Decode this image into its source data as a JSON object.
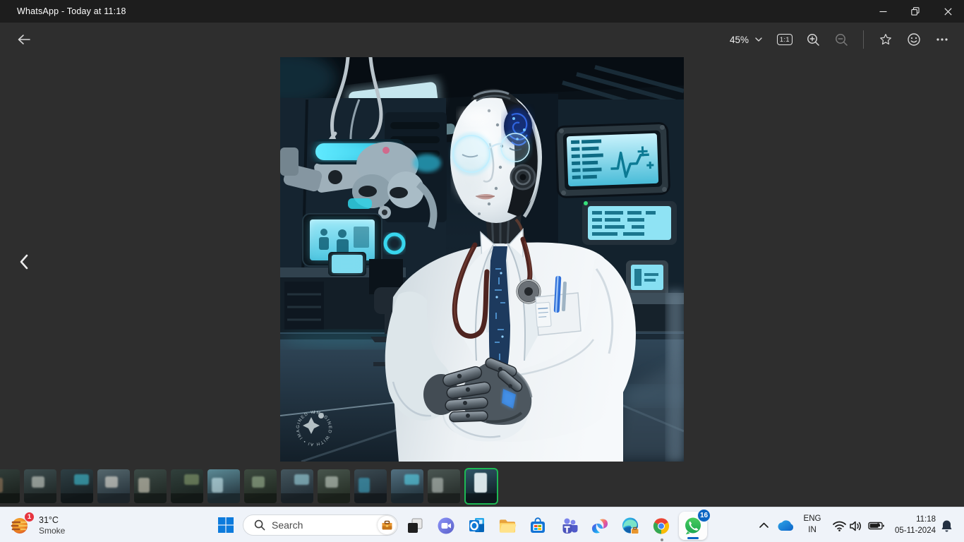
{
  "window": {
    "title": "WhatsApp - Today at 11:18"
  },
  "toolbar": {
    "zoom_level": "45%",
    "actual_size_label": "1:1"
  },
  "viewer": {
    "image_alt": "AI robot doctor standing in a futuristic medical lab",
    "watermark": "IMAGINED WITH AI • IMAGINED WITH AI • "
  },
  "filmstrip": {
    "thumbs": [
      {
        "c1": "#33403c",
        "c2": "#1d2420",
        "ac": "#9a7a5c"
      },
      {
        "c1": "#3c4c4e",
        "c2": "#222b2a",
        "ac": "#cfd4cc"
      },
      {
        "c1": "#2e3f44",
        "c2": "#1a2326",
        "ac": "#3fc3d8"
      },
      {
        "c1": "#54666c",
        "c2": "#2b3840",
        "ac": "#e8e4da"
      },
      {
        "c1": "#3c4a46",
        "c2": "#232c28",
        "ac": "#d8d2c0"
      },
      {
        "c1": "#31403c",
        "c2": "#1d2622",
        "ac": "#8aa070"
      },
      {
        "c1": "#5b8a96",
        "c2": "#2b3f48",
        "ac": "#cfeef4"
      },
      {
        "c1": "#3d4a40",
        "c2": "#232c24",
        "ac": "#9fb694"
      },
      {
        "c1": "#44565e",
        "c2": "#26323a",
        "ac": "#9fd8e4"
      },
      {
        "c1": "#47544c",
        "c2": "#293229",
        "ac": "#c8d2c8"
      },
      {
        "c1": "#3a4a52",
        "c2": "#20282e",
        "ac": "#3ea8c8"
      },
      {
        "c1": "#527080",
        "c2": "#283a44",
        "ac": "#57d8f0"
      },
      {
        "c1": "#4a5652",
        "c2": "#2a312e",
        "ac": "#c0c8c2"
      },
      {
        "c1": "#2e5666",
        "c2": "#14242c",
        "ac": "#e8f4f6",
        "selected": true
      }
    ]
  },
  "taskbar": {
    "weather": {
      "badge": "1",
      "temp": "31°C",
      "condition": "Smoke"
    },
    "search": {
      "placeholder": "Search"
    },
    "apps": [
      "start",
      "search",
      "task-view",
      "chat",
      "outlook",
      "file-explorer",
      "microsoft-store",
      "teams",
      "copilot",
      "edge",
      "chrome",
      "whatsapp"
    ],
    "whatsapp_badge": "16",
    "tray": {
      "language_line1": "ENG",
      "language_line2": "IN",
      "time": "11:18",
      "date": "05-11-2024"
    }
  }
}
